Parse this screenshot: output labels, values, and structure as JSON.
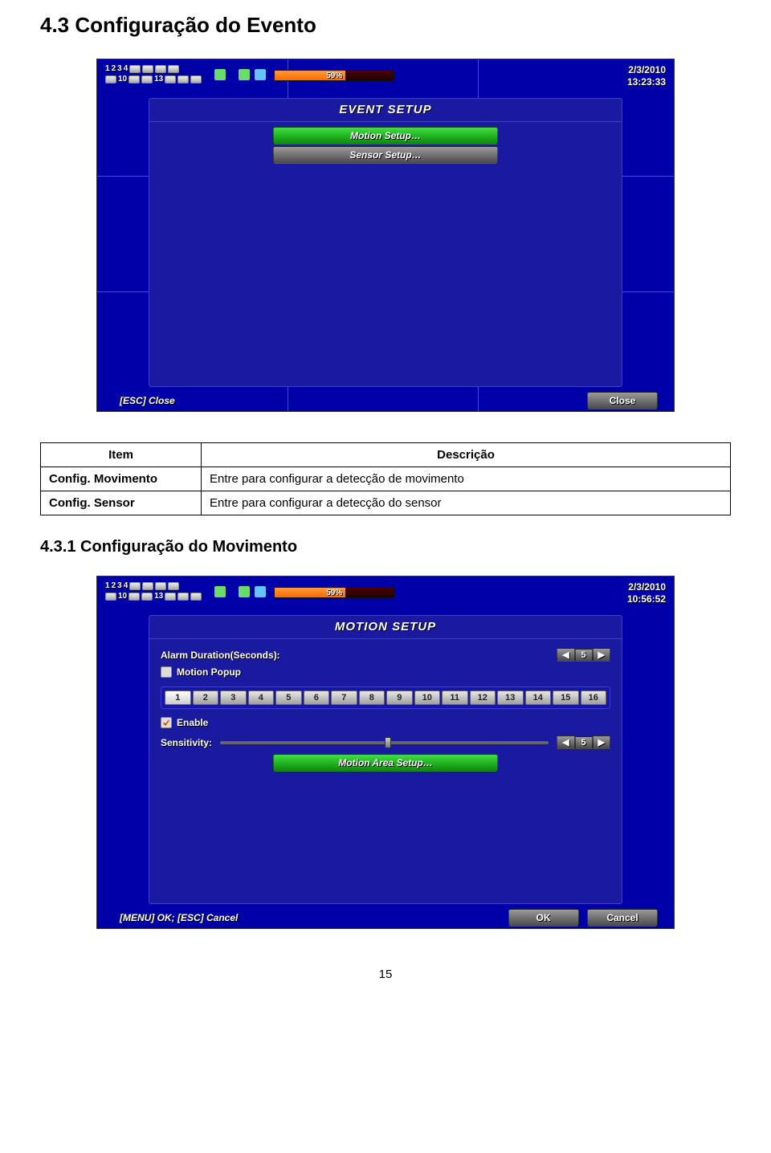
{
  "heading": "4.3 Configuração do Evento",
  "subheading": "4.3.1 Configuração do Movimento",
  "page_number": "15",
  "screenshot1": {
    "channels_row1": [
      "1",
      "2",
      "3",
      "4"
    ],
    "channels_row2_lead": "10",
    "channels_row2_mid": "13",
    "progress_pct": "59%",
    "date": "2/3/2010",
    "time": "13:23:33",
    "panel_title": "EVENT SETUP",
    "btn_motion": "Motion Setup…",
    "btn_sensor": "Sensor Setup…",
    "esc_hint": "[ESC] Close",
    "close_btn": "Close"
  },
  "screenshot2": {
    "progress_pct": "59%",
    "date": "2/3/2010",
    "time": "10:56:52",
    "panel_title": "MOTION SETUP",
    "alarm_label": "Alarm Duration(Seconds):",
    "alarm_value": "5",
    "motion_popup": "Motion Popup",
    "tabs": [
      "1",
      "2",
      "3",
      "4",
      "5",
      "6",
      "7",
      "8",
      "9",
      "10",
      "11",
      "12",
      "13",
      "14",
      "15",
      "16"
    ],
    "enable_label": "Enable",
    "sensitivity_label": "Sensitivity:",
    "sensitivity_value": "5",
    "area_btn": "Motion Area Setup…",
    "esc_hint": "[MENU] OK; [ESC] Cancel",
    "ok_btn": "OK",
    "cancel_btn": "Cancel"
  },
  "table": {
    "head_item": "Item",
    "head_desc": "Descrição",
    "rows": [
      {
        "item": "Config. Movimento",
        "desc": "Entre para configurar a detecção de movimento"
      },
      {
        "item": "Config. Sensor",
        "desc": "Entre para configurar a detecção do sensor"
      }
    ]
  }
}
